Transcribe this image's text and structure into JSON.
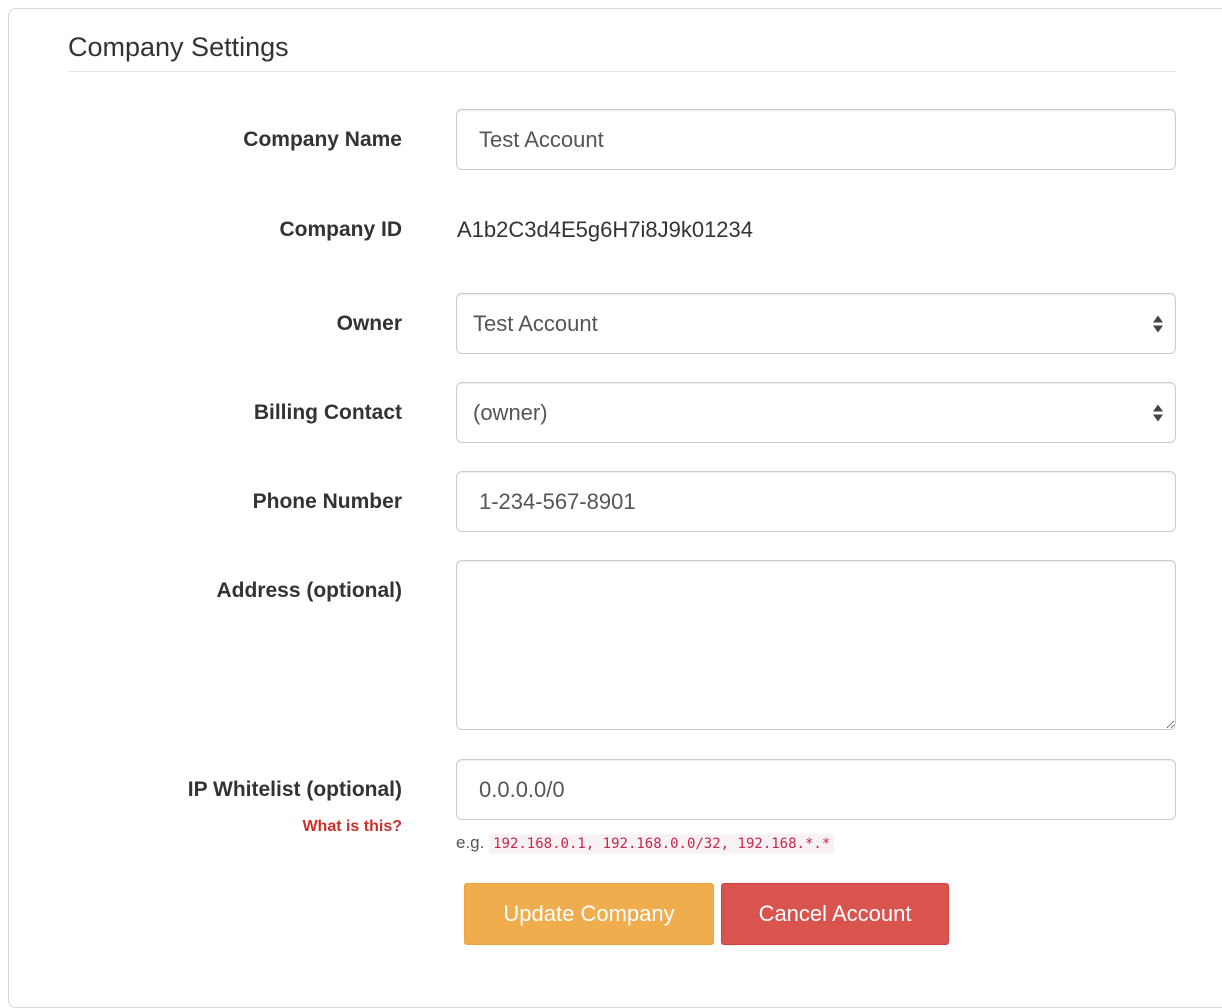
{
  "form": {
    "title": "Company Settings",
    "company_name": {
      "label": "Company Name",
      "value": "Test Account"
    },
    "company_id": {
      "label": "Company ID",
      "value": "A1b2C3d4E5g6H7i8J9k01234"
    },
    "owner": {
      "label": "Owner",
      "selected": "Test Account"
    },
    "billing_contact": {
      "label": "Billing Contact",
      "selected": "(owner)"
    },
    "phone_number": {
      "label": "Phone Number",
      "value": "1-234-567-8901"
    },
    "address": {
      "label": "Address (optional)",
      "value": ""
    },
    "ip_whitelist": {
      "label": "IP Whitelist (optional)",
      "help_link": "What is this?",
      "value": "0.0.0.0/0",
      "help_prefix": "e.g.",
      "help_example": "192.168.0.1, 192.168.0.0/32, 192.168.*.*"
    }
  },
  "actions": {
    "update_label": "Update Company",
    "cancel_label": "Cancel Account"
  },
  "colors": {
    "update_button": "#f0ad4e",
    "cancel_button": "#d9534f",
    "help_link": "#c9302c",
    "code": "#c7254e"
  }
}
